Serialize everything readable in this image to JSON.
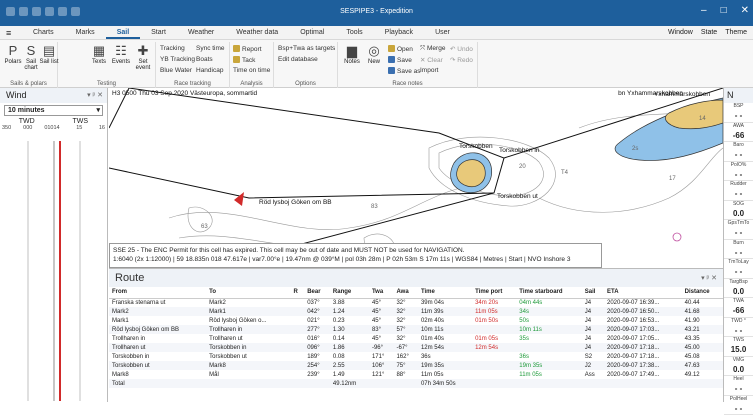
{
  "app": {
    "title": "SESPIPE3 - Expedition"
  },
  "menu": {
    "tabs": [
      "Charts",
      "Marks",
      "Sail",
      "Start",
      "Weather",
      "Weather data",
      "Optimal",
      "Tools",
      "Playback",
      "User"
    ],
    "active_tab": "Sail",
    "right": [
      "Window",
      "State",
      "Theme"
    ]
  },
  "ribbon": {
    "sails_polars": {
      "label": "Sails & polars",
      "polars": "Polars",
      "sail_chart": "Sail chart",
      "sail_list": "Sail list"
    },
    "testing": {
      "label": "Testing",
      "texts": "Texts",
      "events": "Events",
      "set_event": "Set event"
    },
    "race_tracking": {
      "label": "Race tracking",
      "items": [
        "Tracking",
        "Sync time",
        "YB Tracking",
        "Boats",
        "Blue Water",
        "Handicap"
      ]
    },
    "analysis": {
      "label": "Analysis",
      "items": [
        "Report",
        "Tack",
        "Time on time"
      ]
    },
    "options": {
      "label": "Options",
      "items": [
        "Bsp+Twa as targets",
        "Edit database"
      ]
    },
    "race_notes": {
      "label": "Race notes",
      "notes": "Notes",
      "new": "New",
      "items": [
        "Open",
        "Merge",
        "Undo",
        "Save",
        "Clear",
        "Redo",
        "Save as",
        "Import"
      ]
    }
  },
  "wind": {
    "title": "Wind",
    "interval": "10 minutes",
    "col_twd": "TWD",
    "col_tws": "TWS",
    "twd_scale": [
      "350",
      "000",
      "010"
    ],
    "tws_scale": [
      "14",
      "15",
      "16"
    ]
  },
  "map": {
    "status": "H3 0500 Thu 03 Sep 2020 Västeuropa, sommartid",
    "target": "bn Yxhammarskobben",
    "labels": [
      "Torskobben",
      "Torskobben in",
      "Torskobben ut",
      "Röd lysboj Göken om BB",
      "Yxhammarskobben"
    ],
    "depths": [
      "63",
      "83",
      "T4",
      "17",
      "2s",
      "20",
      "14"
    ]
  },
  "enc": {
    "line1": "SSE 25 - The ENC Permit for this cell has expired. This cell may be out of date and MUST NOT be used for NAVIGATION.",
    "line2": "1:6040 (2x 1:12000) | 59 18.835n 018 47.617e | var7.00°e | 19.47nm @ 039°M | pol 03h 28m | P 02h 53m S 17m 11s | WGS84 | Metres | Start | NVO Inshore 3"
  },
  "route": {
    "title": "Route",
    "columns": [
      "From",
      "To",
      "R",
      "Bear",
      "Range",
      "Twa",
      "Awa",
      "Time",
      "Time port",
      "Time starboard",
      "Sail",
      "ETA",
      "Distance"
    ],
    "rows": [
      [
        "Franska stenarna ut",
        "Mark2",
        "",
        "037°",
        "3.88",
        "45°",
        "32°",
        "39m 04s",
        "34m 20s",
        "04m 44s",
        "J4",
        "2020-09-07 16:39...",
        "40.44"
      ],
      [
        "Mark2",
        "Mark1",
        "",
        "042°",
        "1.24",
        "45°",
        "32°",
        "11m 39s",
        "11m 05s",
        "34s",
        "J4",
        "2020-09-07 16:50...",
        "41.68"
      ],
      [
        "Mark1",
        "Röd lysboj Göken o...",
        "",
        "021°",
        "0.23",
        "45°",
        "32°",
        "02m 40s",
        "01m 50s",
        "50s",
        "J4",
        "2020-09-07 16:53...",
        "41.90"
      ],
      [
        "Röd lysboj Göken om BB",
        "Trollharen in",
        "",
        "277°",
        "1.30",
        "83°",
        "57°",
        "10m 11s",
        "",
        "10m 11s",
        "J4",
        "2020-09-07 17:03...",
        "43.21"
      ],
      [
        "Trollharen in",
        "Trollharen ut",
        "",
        "016°",
        "0.14",
        "45°",
        "32°",
        "01m 40s",
        "01m 05s",
        "35s",
        "J4",
        "2020-09-07 17:05...",
        "43.35"
      ],
      [
        "Trollharen ut",
        "Torskobben in",
        "",
        "096°",
        "1.86",
        "-96°",
        "-67°",
        "12m 54s",
        "12m 54s",
        "",
        "J4",
        "2020-09-07 17:18...",
        "45.00"
      ],
      [
        "Torskobben in",
        "Torskobben ut",
        "",
        "189°",
        "0.08",
        "171°",
        "162°",
        "36s",
        "",
        "36s",
        "S2",
        "2020-09-07 17:18...",
        "45.08"
      ],
      [
        "Torskobben ut",
        "Mark8",
        "",
        "254°",
        "2.55",
        "106°",
        "75°",
        "19m 35s",
        "",
        "19m 35s",
        "J2",
        "2020-09-07 17:38...",
        "47.63"
      ],
      [
        "Mark8",
        "Mål",
        "",
        "239°",
        "1.49",
        "121°",
        "88°",
        "11m 05s",
        "",
        "11m 05s",
        "Ass",
        "2020-09-07 17:49...",
        "49.12"
      ]
    ],
    "total": [
      "Total",
      "",
      "",
      "",
      "49.12nm",
      "",
      "",
      "07h 34m 50s",
      "",
      "",
      "",
      "",
      ""
    ],
    "red_port": [
      0,
      1,
      2,
      4,
      5
    ],
    "green_star": [
      0,
      1,
      2,
      3,
      4,
      6,
      7,
      8
    ]
  },
  "instruments": {
    "title": "N",
    "items": [
      {
        "label": "BSP",
        "value": "- -"
      },
      {
        "label": "AWA",
        "value": "-66"
      },
      {
        "label": "Baro",
        "value": "- -"
      },
      {
        "label": "PolO%",
        "value": "- -"
      },
      {
        "label": "Rudder",
        "value": "- -"
      },
      {
        "label": "SOG",
        "value": "0.0"
      },
      {
        "label": "GpsTmTo",
        "value": "- -"
      },
      {
        "label": "Burn",
        "value": "- -"
      },
      {
        "label": "TmToLay",
        "value": "- -"
      },
      {
        "label": "TargBsp",
        "value": "0.0"
      },
      {
        "label": "TWA",
        "value": "-66"
      },
      {
        "label": "TWD °",
        "value": "- -"
      },
      {
        "label": "TWS",
        "value": "15.0"
      },
      {
        "label": "VMG",
        "value": "0.0"
      },
      {
        "label": "Heel",
        "value": "- -"
      },
      {
        "label": "PolHeel",
        "value": "- -"
      }
    ]
  },
  "colors": {
    "accent": "#1e5f9c",
    "port": "#d12a2a",
    "starboard": "#1e9a3a",
    "land": "#e8c97a",
    "shallow": "#8fc1e8"
  }
}
